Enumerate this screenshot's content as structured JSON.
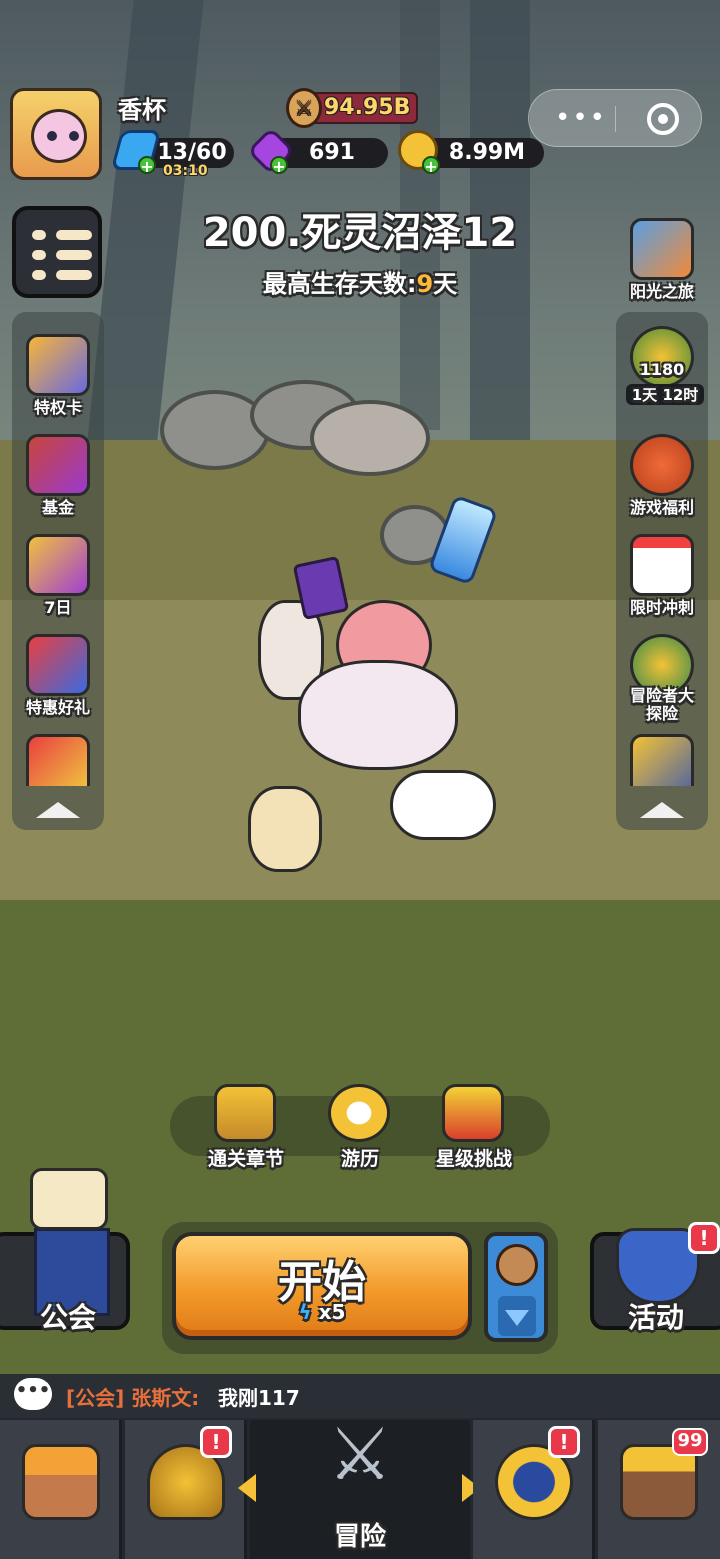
{
  "player": {
    "name": "香杯",
    "power": "94.95B",
    "energy": "13/60",
    "energy_timer": "03:10",
    "gems": "691",
    "gold": "8.99M"
  },
  "capsule": {
    "more_icon": "more-dots-icon",
    "close_icon": "target-icon"
  },
  "stage": {
    "title": "200.死灵沼泽12",
    "best_label": "最高生存天数:",
    "best_value": "9",
    "best_unit": "天"
  },
  "left_panel": {
    "items": [
      {
        "label": "特权卡",
        "icon": "privilege-card-icon"
      },
      {
        "label": "基金",
        "icon": "fund-icon"
      },
      {
        "label": "7日",
        "icon": "seven-day-icon"
      },
      {
        "label": "特惠好礼",
        "icon": "gift-icon"
      }
    ]
  },
  "right_panel": {
    "sunshine_label": "阳光之旅",
    "pass_value": "1180",
    "pass_timer": "1天 12时",
    "items": [
      {
        "label": "游戏福利",
        "icon": "welfare-bag-icon"
      },
      {
        "label": "限时冲刺",
        "icon": "calendar-icon"
      },
      {
        "label": "冒险者大\n探险",
        "line1": "冒险者大",
        "line2": "探险",
        "icon": "adventure-icon"
      }
    ]
  },
  "mid_buttons": [
    {
      "label": "通关章节",
      "icon": "chapter-chest-icon"
    },
    {
      "label": "游历",
      "icon": "compass-icon"
    },
    {
      "label": "星级挑战",
      "icon": "star-challenge-icon"
    }
  ],
  "actions": {
    "guild_label": "公会",
    "start_label": "开始",
    "start_cost": "x5",
    "event_label": "活动",
    "alert": "!"
  },
  "chat": {
    "tag": "[公会] 张斯文:",
    "message": "我刚117"
  },
  "nav": {
    "center_label": "冒险",
    "items": [
      "shop-icon",
      "helmet-icon",
      "upgrade-icon",
      "chest-icon"
    ],
    "chest_badge": "99",
    "alert": "!"
  },
  "colors": {
    "accent_orange": "#f29a2a",
    "gold_text": "#ffb838",
    "alert_red": "#e8384a"
  }
}
